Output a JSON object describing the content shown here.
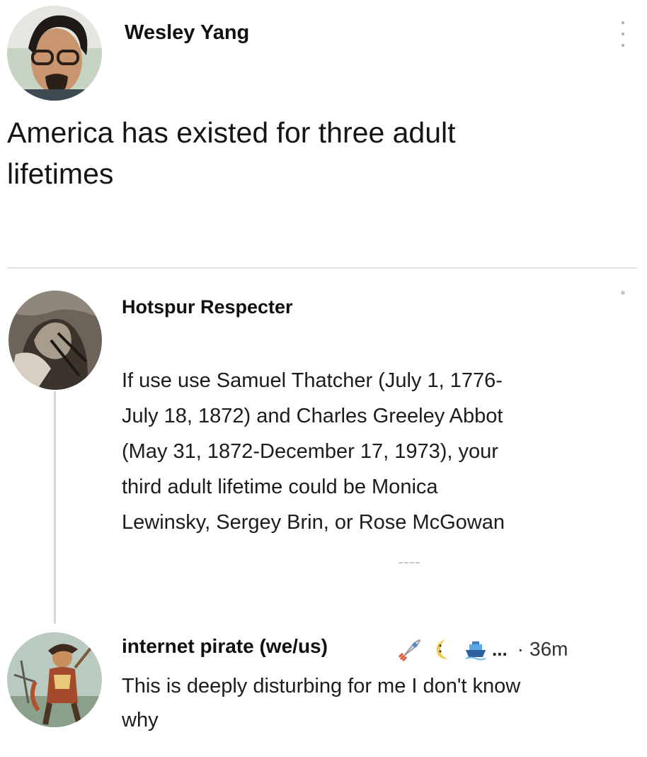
{
  "posts": [
    {
      "author": "Wesley Yang",
      "lines": [
        "America has existed for three adult",
        "lifetimes"
      ]
    },
    {
      "author": "Hotspur Respecter",
      "lines": [
        "If use use Samuel Thatcher (July 1, 1776-",
        "July 18, 1872) and Charles Greeley Abbot",
        "(May 31, 1872-December 17, 1973), your",
        "third adult lifetime could be Monica",
        "Lewinsky, Sergey Brin, or Rose McGowan"
      ]
    },
    {
      "author": "internet pirate (we/us)",
      "name_emojis": [
        "rocket-emoji",
        "crescent-moon-emoji",
        "ship-emoji"
      ],
      "truncation": "...",
      "separator": "·",
      "time": "36m",
      "lines": [
        "This is deeply disturbing for me I don't know",
        "why"
      ]
    }
  ],
  "colors": {
    "text": "#1a1a1a",
    "divider": "#e4e4e4",
    "thread_line": "#d6d6d6",
    "meta": "#333333"
  }
}
